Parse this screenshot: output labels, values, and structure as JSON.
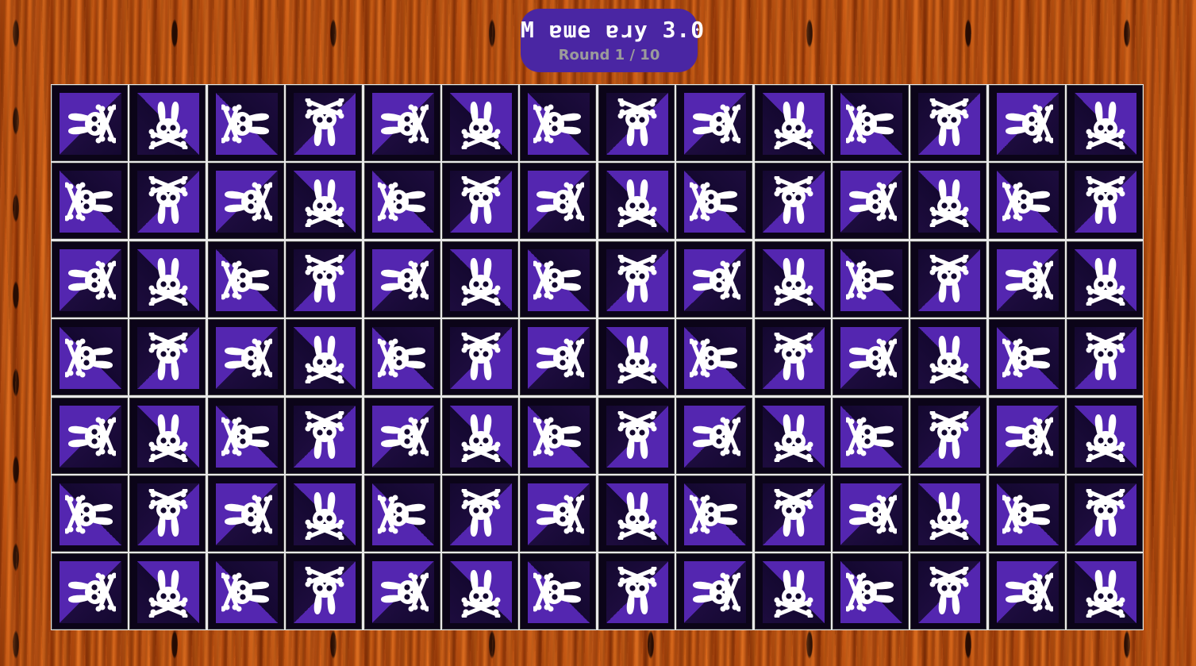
{
  "header": {
    "title": "M ɐɯe ɐɹy 3.0",
    "round_label": "Round 1 / 10"
  },
  "board": {
    "rows": 7,
    "columns": 14,
    "tile_icon": "bunny-skull-crossbones-icon",
    "tiles_face_down": true
  },
  "colors": {
    "header_bg": "#4a26a3",
    "tile_accent": "#5426b0",
    "tile_dark": "#140830",
    "board_border": "#e8e8e8",
    "wood": "#b4480c"
  }
}
